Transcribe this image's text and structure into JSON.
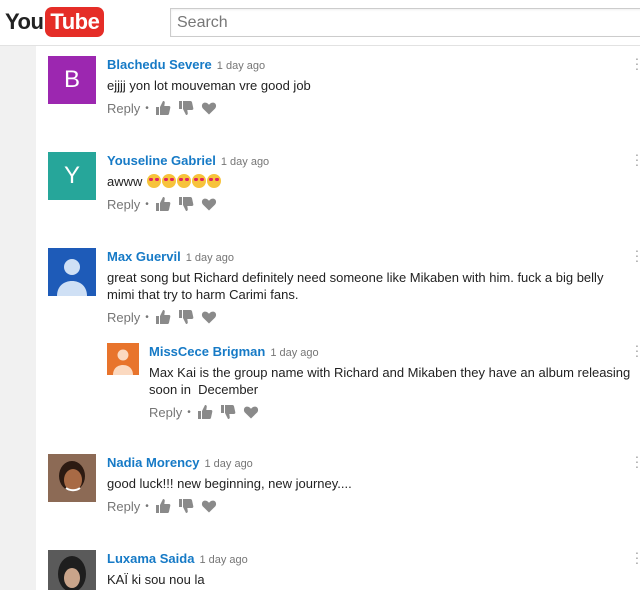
{
  "header": {
    "logo_you": "You",
    "logo_tube": "Tube",
    "search_placeholder": "Search"
  },
  "comments": [
    {
      "author": "Blachedu Severe",
      "time": "1 day ago",
      "text": "ejjjj yon lot mouveman vre good job",
      "avatar_letter": "B",
      "avatar_color": "#9c27b0",
      "reply_label": "Reply"
    },
    {
      "author": "Youseline Gabriel",
      "time": "1 day ago",
      "text": "awww",
      "emoji_count": 5,
      "avatar_letter": "Y",
      "avatar_color": "#26a69a",
      "reply_label": "Reply"
    },
    {
      "author": "Max Guervil",
      "time": "1 day ago",
      "text_line1": "great song but Richard definitely need someone like Mikaben with him. fuck a big belly",
      "text_line2": "mimi that try to harm Carimi fans.",
      "avatar_color": "#1e5bb8",
      "reply_label": "Reply"
    },
    {
      "author": "MissCece Brigman",
      "time": "1 day ago",
      "text_line1": "Max Kai is the group name with Richard and Mikaben they have an album releasing",
      "text_line2": "soon in  December",
      "avatar_color": "#e8742c",
      "reply_label": "Reply"
    },
    {
      "author": "Nadia Morency",
      "time": "1 day ago",
      "text": "good luck!!! new beginning, new journey....",
      "reply_label": "Reply"
    },
    {
      "author": "Luxama Saida",
      "time": "1 day ago",
      "text": "KAÏ ki sou nou la"
    }
  ]
}
